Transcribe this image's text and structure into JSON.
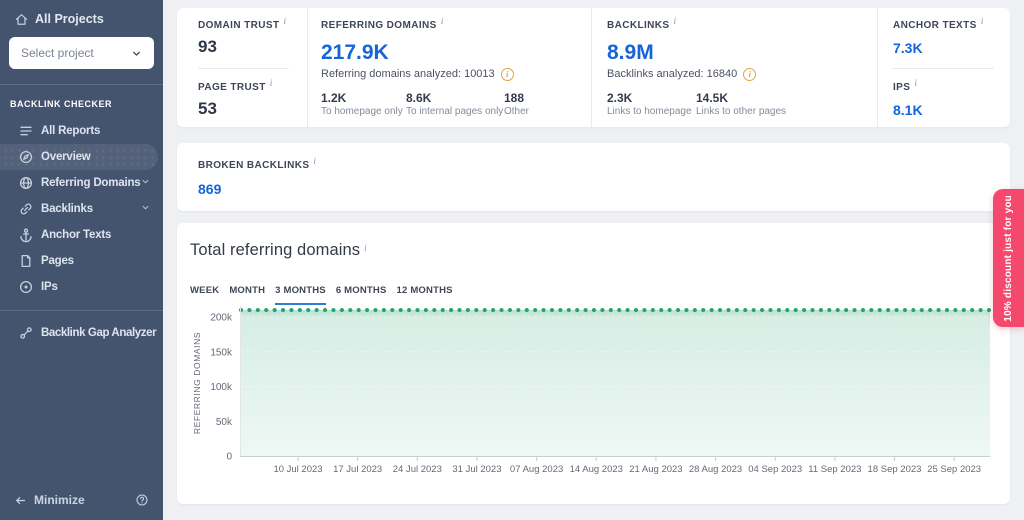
{
  "glyphs": {
    "info": "i"
  },
  "colors": {
    "sidebar_bg": "#45546e",
    "sidebar_active_pill": "#54617a",
    "main_bg": "#eef0f4",
    "accent_blue": "#1565d8",
    "tab_underline_blue": "#2e7cd6",
    "warning_orange": "#e8a33c",
    "chart_green": "#27a371",
    "ribbon_pink": "#f5486d"
  },
  "sidebar": {
    "all_projects_label": "All Projects",
    "project_select_placeholder": "Select project",
    "section_label": "BACKLINK CHECKER",
    "items": [
      {
        "label": "All Reports",
        "icon": "reports-icon",
        "active": false,
        "chevron": false
      },
      {
        "label": "Overview",
        "icon": "overview-icon",
        "active": true,
        "chevron": false
      },
      {
        "label": "Referring Domains",
        "icon": "globe-icon",
        "active": false,
        "chevron": true
      },
      {
        "label": "Backlinks",
        "icon": "link-icon",
        "active": false,
        "chevron": true
      },
      {
        "label": "Anchor Texts",
        "icon": "anchor-icon",
        "active": false,
        "chevron": false
      },
      {
        "label": "Pages",
        "icon": "page-icon",
        "active": false,
        "chevron": false
      },
      {
        "label": "IPs",
        "icon": "target-icon",
        "active": false,
        "chevron": false
      }
    ],
    "tools": [
      {
        "label": "Backlink Gap Analyzer",
        "icon": "gap-analyzer-icon"
      }
    ],
    "footer": {
      "minimize_label": "Minimize"
    }
  },
  "stats": {
    "domain_trust": {
      "label": "DOMAIN TRUST",
      "value": "93"
    },
    "page_trust": {
      "label": "PAGE TRUST",
      "value": "53"
    },
    "referring_domains": {
      "label": "REFERRING DOMAINS",
      "value": "217.9K",
      "analyzed": "Referring domains analyzed: 10013",
      "breakdown": [
        {
          "value": "1.2K",
          "label": "To homepage only"
        },
        {
          "value": "8.6K",
          "label": "To internal pages only"
        },
        {
          "value": "188",
          "label": "Other"
        }
      ]
    },
    "backlinks": {
      "label": "BACKLINKS",
      "value": "8.9M",
      "analyzed": "Backlinks analyzed: 16840",
      "breakdown": [
        {
          "value": "2.3K",
          "label": "Links to homepage"
        },
        {
          "value": "14.5K",
          "label": "Links to other pages"
        }
      ]
    },
    "anchor_texts": {
      "label": "ANCHOR TEXTS",
      "value": "7.3K"
    },
    "ips": {
      "label": "IPS",
      "value": "8.1K"
    },
    "broken_backlinks": {
      "label": "BROKEN BACKLINKS",
      "value": "869"
    }
  },
  "chart_section": {
    "title": "Total referring domains",
    "tabs": [
      {
        "label": "WEEK",
        "active": false
      },
      {
        "label": "MONTH",
        "active": false
      },
      {
        "label": "3 MONTHS",
        "active": true
      },
      {
        "label": "6 MONTHS",
        "active": false
      },
      {
        "label": "12 MONTHS",
        "active": false
      }
    ]
  },
  "chart_data": {
    "type": "area",
    "title": "Total referring domains",
    "ylabel": "REFERRING DOMAINS",
    "xlabel": "",
    "ylim": [
      0,
      215000
    ],
    "yticks": [
      {
        "value": 0,
        "label": "0"
      },
      {
        "value": 50000,
        "label": "50k"
      },
      {
        "value": 100000,
        "label": "100k"
      },
      {
        "value": 150000,
        "label": "150k"
      },
      {
        "value": 200000,
        "label": "200k"
      }
    ],
    "x_tick_labels": [
      "10 Jul 2023",
      "17 Jul 2023",
      "24 Jul 2023",
      "31 Jul 2023",
      "07 Aug 2023",
      "14 Aug 2023",
      "21 Aug 2023",
      "28 Aug 2023",
      "04 Sep 2023",
      "11 Sep 2023",
      "18 Sep 2023",
      "25 Sep 2023"
    ],
    "num_points": 90,
    "series": [
      {
        "name": "Referring domains",
        "constant_value": 210000
      }
    ],
    "legend": false,
    "grid": "dashed-horizontal",
    "line_style": "dotted",
    "line_color": "#27a371",
    "area_fill_top": "rgba(39,163,113,0.32)",
    "area_fill_bottom": "rgba(39,163,113,0.08)"
  },
  "ribbon": {
    "text": "10% discount just for you"
  }
}
